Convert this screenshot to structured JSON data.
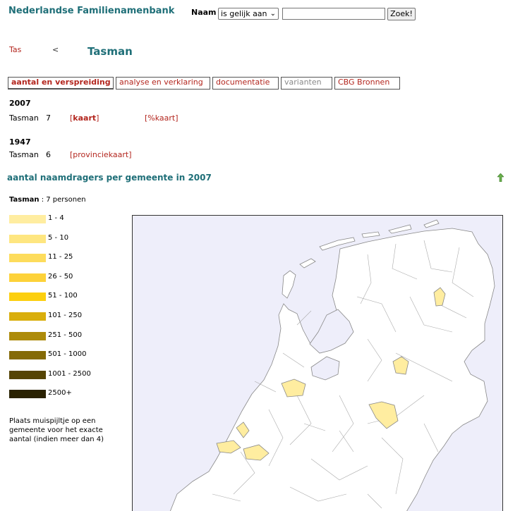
{
  "header": {
    "site_title": "Nederlandse Familienamenbank",
    "search_label": "Naam",
    "search_mode": "is gelijk aan",
    "search_value": "",
    "search_button": "Zoek!"
  },
  "nav": {
    "prev_name": "Tas",
    "prev_arrow": "<",
    "current_name": "Tasman"
  },
  "tabs": [
    {
      "label": "aantal en verspreiding"
    },
    {
      "label": "analyse en verklaring"
    },
    {
      "label": "documentatie"
    },
    {
      "label": "varianten"
    },
    {
      "label": "CBG Bronnen"
    }
  ],
  "census": [
    {
      "year": "2007",
      "name": "Tasman",
      "count": "7",
      "links": [
        "kaart",
        "%kaart"
      ]
    },
    {
      "year": "1947",
      "name": "Tasman",
      "count": "6",
      "links": [
        "provinciekaart"
      ]
    }
  ],
  "map_section": {
    "title": "aantal naamdragers per gemeente in 2007",
    "name": "Tasman",
    "persons": ": 7 personen",
    "legend": [
      {
        "label": "1 - 4",
        "color": "#ffeda0"
      },
      {
        "label": "5 - 10",
        "color": "#fee680"
      },
      {
        "label": "11 - 25",
        "color": "#fddc5c"
      },
      {
        "label": "26 - 50",
        "color": "#fdd23a"
      },
      {
        "label": "51 - 100",
        "color": "#fccf0f"
      },
      {
        "label": "101 - 250",
        "color": "#d9ae0c"
      },
      {
        "label": "251 - 500",
        "color": "#ad8b0a"
      },
      {
        "label": "501 - 1000",
        "color": "#846a07"
      },
      {
        "label": "1001 - 2500",
        "color": "#554404"
      },
      {
        "label": "2500+",
        "color": "#2a2202"
      }
    ],
    "hint": "Plaats muispijltje op een gemeente voor het exacte aantal (indien meer dan 4)",
    "highlight_color": "#ffeda0",
    "background_color": "#eeeefa"
  }
}
